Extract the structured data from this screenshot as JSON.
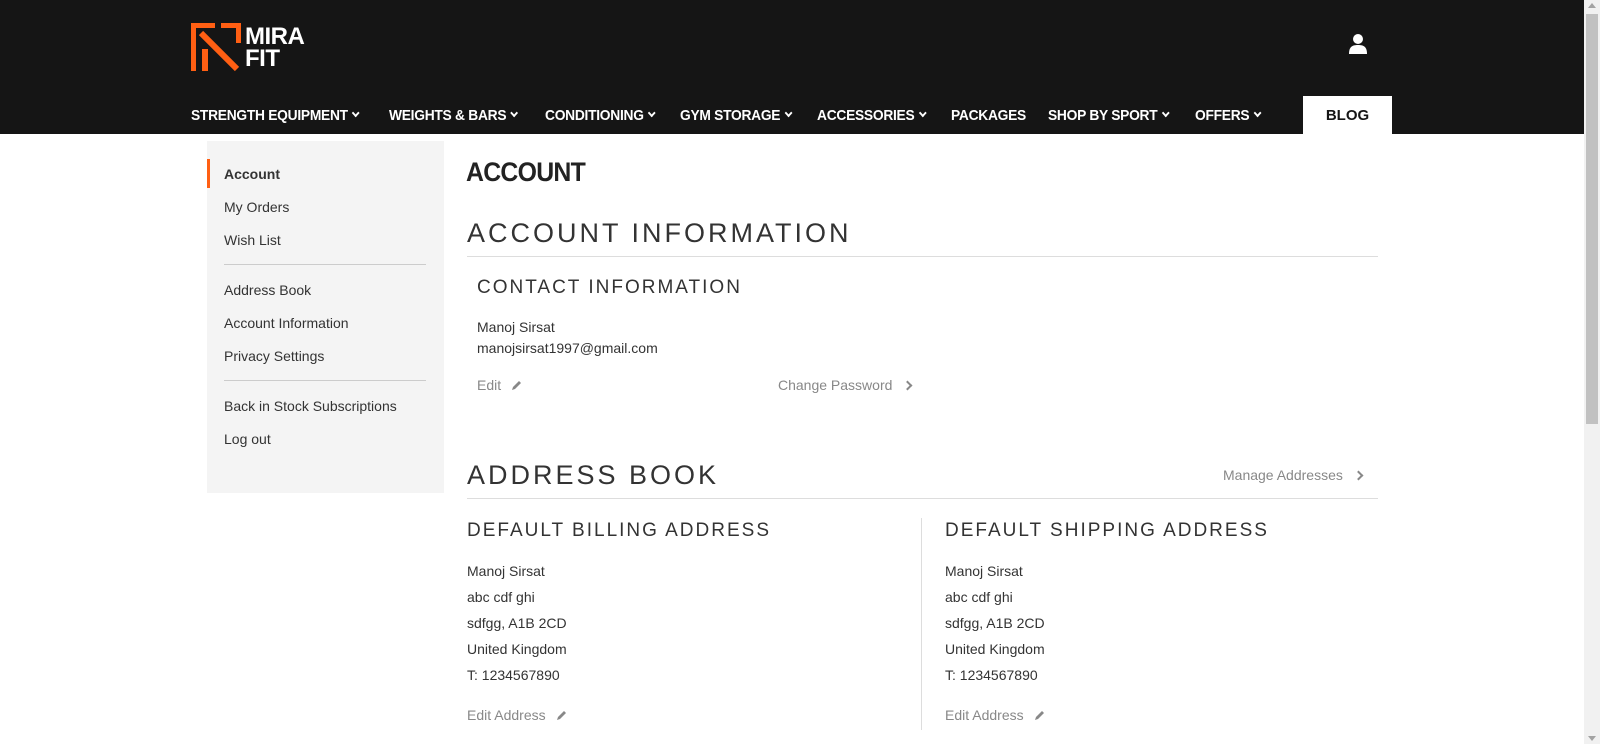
{
  "brand": {
    "logo_line1": "MIRA",
    "logo_line2": "FIT",
    "accent": "#ff5f13",
    "header_bg": "#151515"
  },
  "nav": {
    "items": [
      {
        "label": "STRENGTH EQUIPMENT",
        "has_dropdown": true
      },
      {
        "label": "WEIGHTS & BARS",
        "has_dropdown": true
      },
      {
        "label": "CONDITIONING",
        "has_dropdown": true
      },
      {
        "label": "GYM STORAGE",
        "has_dropdown": true
      },
      {
        "label": "ACCESSORIES",
        "has_dropdown": true
      },
      {
        "label": "PACKAGES",
        "has_dropdown": false
      },
      {
        "label": "SHOP BY SPORT",
        "has_dropdown": true
      },
      {
        "label": "OFFERS",
        "has_dropdown": true
      }
    ],
    "blog_label": "BLOG",
    "user_icon": "user-icon"
  },
  "sidebar": {
    "items": [
      {
        "label": "Account",
        "active": true
      },
      {
        "label": "My Orders"
      },
      {
        "label": "Wish List"
      },
      {
        "label": "Address Book"
      },
      {
        "label": "Account Information"
      },
      {
        "label": "Privacy Settings"
      },
      {
        "label": "Back in Stock Subscriptions"
      },
      {
        "label": "Log out"
      }
    ]
  },
  "main": {
    "page_title": "ACCOUNT",
    "account_info": {
      "title": "ACCOUNT INFORMATION",
      "contact_title": "CONTACT INFORMATION",
      "name": "Manoj Sirsat",
      "email": "manojsirsat1997@gmail.com",
      "edit_label": "Edit",
      "change_password_label": "Change Password"
    },
    "address_book": {
      "title": "ADDRESS BOOK",
      "manage_label": "Manage Addresses",
      "billing": {
        "title": "DEFAULT BILLING ADDRESS",
        "lines": [
          "Manoj Sirsat",
          "abc cdf ghi",
          "sdfgg, A1B 2CD",
          "United Kingdom",
          "T: 1234567890"
        ],
        "edit_label": "Edit Address"
      },
      "shipping": {
        "title": "DEFAULT SHIPPING ADDRESS",
        "lines": [
          "Manoj Sirsat",
          "abc cdf ghi",
          "sdfgg, A1B 2CD",
          "United Kingdom",
          "T: 1234567890"
        ],
        "edit_label": "Edit Address"
      }
    }
  }
}
